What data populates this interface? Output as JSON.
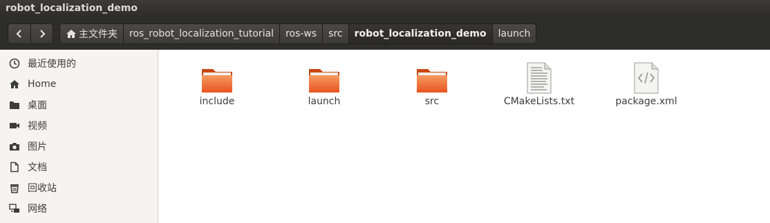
{
  "window": {
    "title": "robot_localization_demo"
  },
  "toolbar": {
    "back_icon": "chevron-left-icon",
    "forward_icon": "chevron-right-icon",
    "breadcrumbs": [
      {
        "label": "主文件夹",
        "icon": "home-icon"
      },
      {
        "label": "ros_robot_localization_tutorial"
      },
      {
        "label": "ros-ws"
      },
      {
        "label": "src"
      },
      {
        "label": "robot_localization_demo",
        "active": true
      },
      {
        "label": "launch"
      }
    ]
  },
  "sidebar": {
    "items": [
      {
        "label": "最近使用的",
        "icon": "clock-icon"
      },
      {
        "label": "Home",
        "icon": "home-icon"
      },
      {
        "label": "桌面",
        "icon": "folder-icon"
      },
      {
        "label": "视频",
        "icon": "video-icon"
      },
      {
        "label": "图片",
        "icon": "camera-icon"
      },
      {
        "label": "文档",
        "icon": "document-icon"
      },
      {
        "label": "回收站",
        "icon": "trash-icon"
      },
      {
        "label": "网络",
        "icon": "network-icon"
      }
    ]
  },
  "files": [
    {
      "name": "include",
      "type": "folder"
    },
    {
      "name": "launch",
      "type": "folder"
    },
    {
      "name": "src",
      "type": "folder"
    },
    {
      "name": "CMakeLists.txt",
      "type": "text"
    },
    {
      "name": "package.xml",
      "type": "xml"
    }
  ],
  "colors": {
    "folder": "#e95420",
    "folder_light": "#f59a62",
    "titlebar": "#3c3b37"
  }
}
